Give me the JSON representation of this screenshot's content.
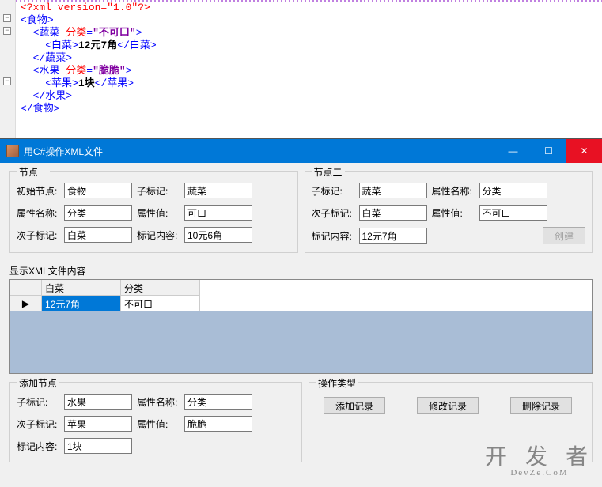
{
  "xml": {
    "decl": "<?xml version=\"1.0\"?>",
    "root_open": "食物",
    "veg_open": "蔬菜",
    "veg_attr_name": "分类",
    "veg_attr_val": "不可口",
    "cabbage": "白菜",
    "cabbage_val": "12元7角",
    "fruit_open": "水果",
    "fruit_attr_name": "分类",
    "fruit_attr_val": "脆脆",
    "apple": "苹果",
    "apple_val": "1块"
  },
  "window": {
    "title": "用C#操作XML文件"
  },
  "group1": {
    "legend": "节点一",
    "labels": {
      "init": "初始节点:",
      "subtag": "子标记:",
      "attrname": "属性名称:",
      "attrval": "属性值:",
      "subsubtag": "次子标记:",
      "tagcontent": "标记内容:"
    },
    "values": {
      "init": "食物",
      "subtag": "蔬菜",
      "attrname": "分类",
      "attrval": "可口",
      "subsubtag": "白菜",
      "tagcontent": "10元6角"
    }
  },
  "group2": {
    "legend": "节点二",
    "labels": {
      "subtag": "子标记:",
      "attrname": "属性名称:",
      "subsubtag": "次子标记:",
      "attrval": "属性值:",
      "tagcontent": "标记内容:"
    },
    "values": {
      "subtag": "蔬菜",
      "attrname": "分类",
      "subsubtag": "白菜",
      "attrval": "不可口",
      "tagcontent": "12元7角"
    },
    "create_btn": "创建"
  },
  "grid": {
    "label": "显示XML文件内容",
    "headers": {
      "c1": "白菜",
      "c2": "分类"
    },
    "row": {
      "c1": "12元7角",
      "c2": "不可口"
    },
    "row_indicator": "▶"
  },
  "group3": {
    "legend": "添加节点",
    "labels": {
      "subtag": "子标记:",
      "attrname": "属性名称:",
      "subsubtag": "次子标记:",
      "attrval": "属性值:",
      "tagcontent": "标记内容:"
    },
    "values": {
      "subtag": "水果",
      "attrname": "分类",
      "subsubtag": "苹果",
      "attrval": "脆脆",
      "tagcontent": "1块"
    }
  },
  "group4": {
    "legend": "操作类型",
    "buttons": {
      "add": "添加记录",
      "modify": "修改记录",
      "delete": "删除记录"
    }
  },
  "watermark": {
    "main": "开 发 者",
    "sub": "DevZe.CoM"
  }
}
